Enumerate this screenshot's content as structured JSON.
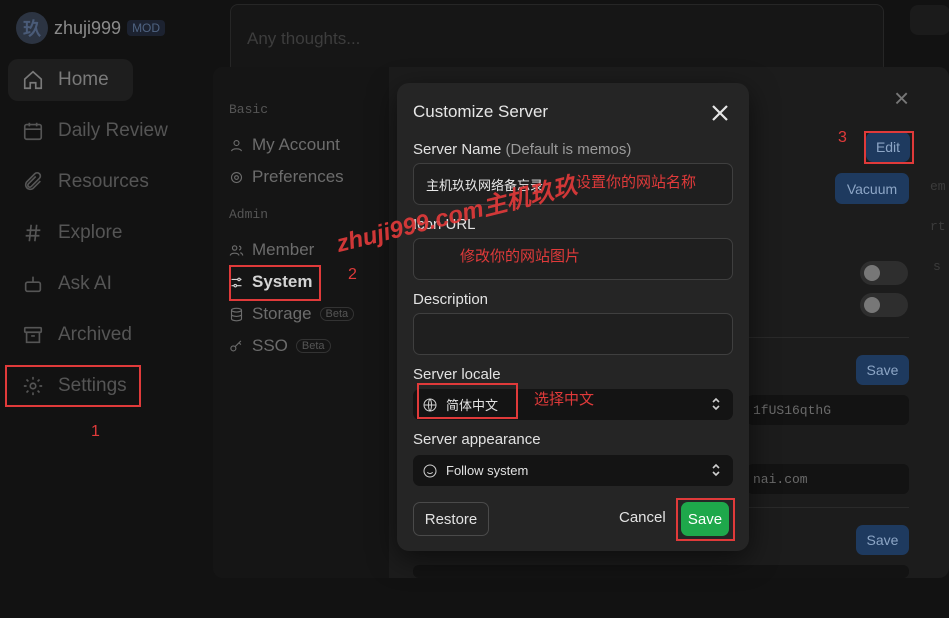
{
  "brand": {
    "avatar_char": "玖",
    "name": "zhuji999",
    "badge": "MOD"
  },
  "nav": [
    {
      "label": "Home",
      "icon": "home-icon"
    },
    {
      "label": "Daily Review",
      "icon": "calendar-icon"
    },
    {
      "label": "Resources",
      "icon": "paperclip-icon"
    },
    {
      "label": "Explore",
      "icon": "hash-icon"
    },
    {
      "label": "Ask AI",
      "icon": "robot-icon"
    },
    {
      "label": "Archived",
      "icon": "archive-icon"
    },
    {
      "label": "Settings",
      "icon": "gear-icon"
    }
  ],
  "editor": {
    "placeholder": "Any thoughts..."
  },
  "settings": {
    "basic_title": "Basic",
    "admin_title": "Admin",
    "items": [
      {
        "label": "My Account",
        "icon": "user-icon"
      },
      {
        "label": "Preferences",
        "icon": "cog-icon"
      },
      {
        "label": "Member",
        "icon": "users-icon"
      },
      {
        "label": "System",
        "icon": "sliders-icon"
      },
      {
        "label": "Storage",
        "icon": "database-icon",
        "badge": "Beta"
      },
      {
        "label": "SSO",
        "icon": "key-icon",
        "badge": "Beta"
      }
    ],
    "edit_label": "Edit",
    "vacuum_label": "Vacuum",
    "save_label": "Save",
    "fragments": {
      "token": "1fUS16qthG",
      "email": "nai.com",
      "side_em": "em",
      "side_rt": "rt",
      "side_s": "s"
    }
  },
  "modal": {
    "title": "Customize Server",
    "server_name_label": "Server Name",
    "server_name_hint": "(Default is memos)",
    "server_name_value": "主机玖玖网络备忘录",
    "icon_url_label": "Icon URL",
    "icon_url_value": "",
    "description_label": "Description",
    "description_value": "",
    "locale_label": "Server locale",
    "locale_value": "简体中文",
    "appearance_label": "Server appearance",
    "appearance_value": "Follow system",
    "restore_label": "Restore",
    "cancel_label": "Cancel",
    "save_label": "Save"
  },
  "annotations": {
    "n1": "1",
    "n2": "2",
    "n3": "3",
    "name_note": "设置你的网站名称",
    "icon_note": "修改你的网站图片",
    "locale_note": "选择中文",
    "watermark": "zhuji999.com主机玖玖"
  },
  "colors": {
    "accent_green": "#1ea84b",
    "annotation_red": "#e03a3a",
    "edit_blue": "#1e3a5f"
  }
}
